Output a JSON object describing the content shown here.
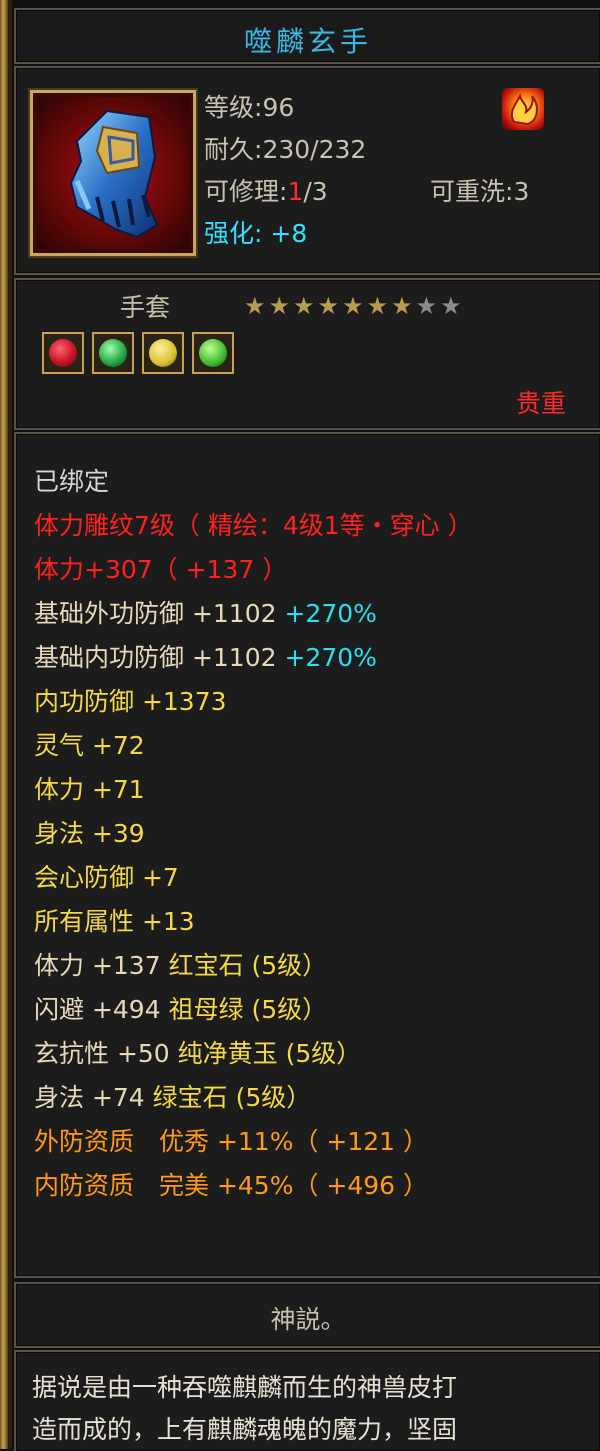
{
  "title": "噬麟玄手",
  "info": {
    "level_label": "等级:",
    "level_value": "96",
    "durability_label": "耐久:",
    "durability_value": "230/232",
    "repair_label": "可修理:",
    "repair_current": "1",
    "repair_total": "/3",
    "reset_label": "可重洗:",
    "reset_value": "3",
    "enhance_label": "强化:",
    "enhance_value": "+8"
  },
  "type": {
    "name": "手套",
    "stars_filled": 7,
    "stars_total": 9,
    "rarity": "贵重"
  },
  "colors": {
    "title": "#38b8e0",
    "red": "#ff2020",
    "cyan": "#28e0f0",
    "yellow": "#f4d848",
    "orange": "#ff9a18",
    "beige": "#e8d8b8"
  },
  "gems": [
    {
      "name": "红宝石",
      "color": "#d01020"
    },
    {
      "name": "祖母绿",
      "color": "#20a040"
    },
    {
      "name": "纯净黄玉",
      "color": "#d8c030"
    },
    {
      "name": "绿宝石",
      "color": "#40b830"
    }
  ],
  "stats": {
    "bound": "已绑定",
    "engrave": "体力雕纹7级（ 精绘：4级1等・穿心 ）",
    "stamina_base": "体力+307（ +137 ）",
    "ext_def_label": "基础外功防御 +1102",
    "ext_def_pct": "+270%",
    "int_def_label": "基础内功防御 +1102",
    "int_def_pct": "+270%",
    "inner_def": "内功防御 +1373",
    "spirit": "灵气 +72",
    "stamina": "体力 +71",
    "agility": "身法 +39",
    "crit_def": "会心防御 +7",
    "all_attr": "所有属性 +13",
    "gem1_stat": "体力 +137",
    "gem1_name": "红宝石 (5级）",
    "gem2_stat": "闪避 +494",
    "gem2_name": "祖母绿 (5级）",
    "gem3_stat": "玄抗性 +50",
    "gem3_name": "纯净黄玉 (5级）",
    "gem4_stat": "身法 +74",
    "gem4_name": "绿宝石 (5级）",
    "ext_quality": "外防资质　优秀 +11%（ +121 ）",
    "int_quality": "内防资质　完美 +45%（ +496 ）"
  },
  "lore": {
    "title": "神説。",
    "line1": "据说是由一种吞噬麒麟而生的神兽皮打",
    "line2": "造而成的，上有麒麟魂魄的魔力，坚固"
  }
}
